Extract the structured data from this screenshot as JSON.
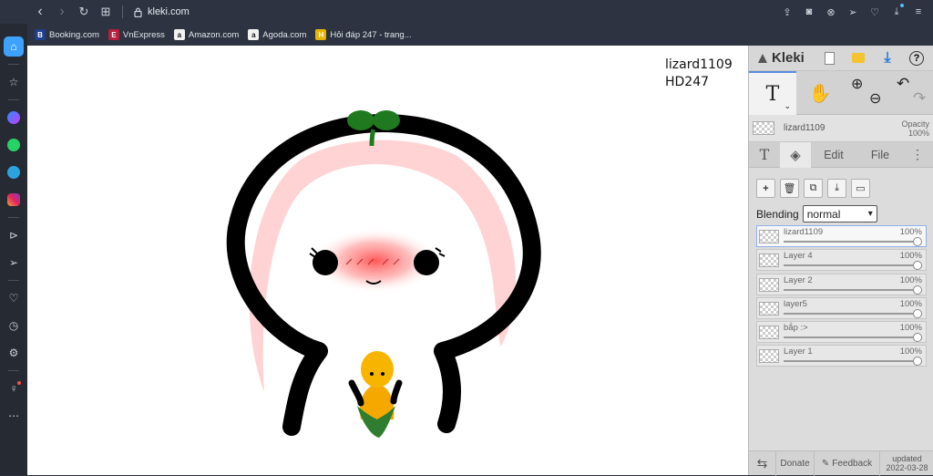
{
  "browser": {
    "url": "kleki.com",
    "nav": {
      "back": "‹",
      "forward": "›",
      "reload": "↻",
      "grid": "⊞"
    },
    "right_icons": [
      "share-icon",
      "camera-icon",
      "block-icon",
      "send-icon",
      "heart-icon",
      "download-icon",
      "menu-icon"
    ]
  },
  "bookmarks": [
    {
      "label": "Booking.com",
      "icon_char": "B",
      "color": "#1f3f8f"
    },
    {
      "label": "VnExpress",
      "icon_char": "E",
      "color": "#b81e3e"
    },
    {
      "label": "Amazon.com",
      "icon_char": "a",
      "color": "#f2f2f2"
    },
    {
      "label": "Agoda.com",
      "icon_char": "a",
      "color": "#f2f2f2"
    },
    {
      "label": "Hỏi đáp 247 - trang...",
      "icon_char": "H",
      "color": "#e8b400"
    }
  ],
  "sidebar_icons": [
    "home-icon",
    "star-icon",
    "messenger-icon",
    "whatsapp-icon",
    "telegram-icon",
    "instagram-icon",
    "play-icon",
    "send-icon",
    "heart-icon",
    "clock-icon",
    "settings-icon",
    "bulb-icon",
    "more-icon"
  ],
  "canvas": {
    "signature_line1": "lizard1109",
    "signature_line2": "HD247"
  },
  "kleki": {
    "logo_text": "Kleki",
    "tool_text": "T",
    "zoom_in": "⊕",
    "zoom_out": "⊖",
    "undo": "↶",
    "redo": "↷",
    "color_label": "lizard1109",
    "opacity_label": "Opacity",
    "opacity_value": "100%",
    "tabs": {
      "text": "T",
      "edit": "Edit",
      "file": "File",
      "more": "⋮"
    },
    "blending_label": "Blending",
    "blending_value": "normal",
    "layers": [
      {
        "name": "lizard1109",
        "opacity": "100%",
        "active": true
      },
      {
        "name": "Layer 4",
        "opacity": "100%",
        "active": false
      },
      {
        "name": "Layer 2",
        "opacity": "100%",
        "active": false
      },
      {
        "name": "layer5",
        "opacity": "100%",
        "active": false
      },
      {
        "name": "bắp :>",
        "opacity": "100%",
        "active": false
      },
      {
        "name": "Layer 1",
        "opacity": "100%",
        "active": false
      }
    ],
    "footer": {
      "swap": "⇆",
      "donate": "Donate",
      "feedback": "Feedback",
      "updated_label": "updated",
      "updated_date": "2022-03-28"
    }
  }
}
